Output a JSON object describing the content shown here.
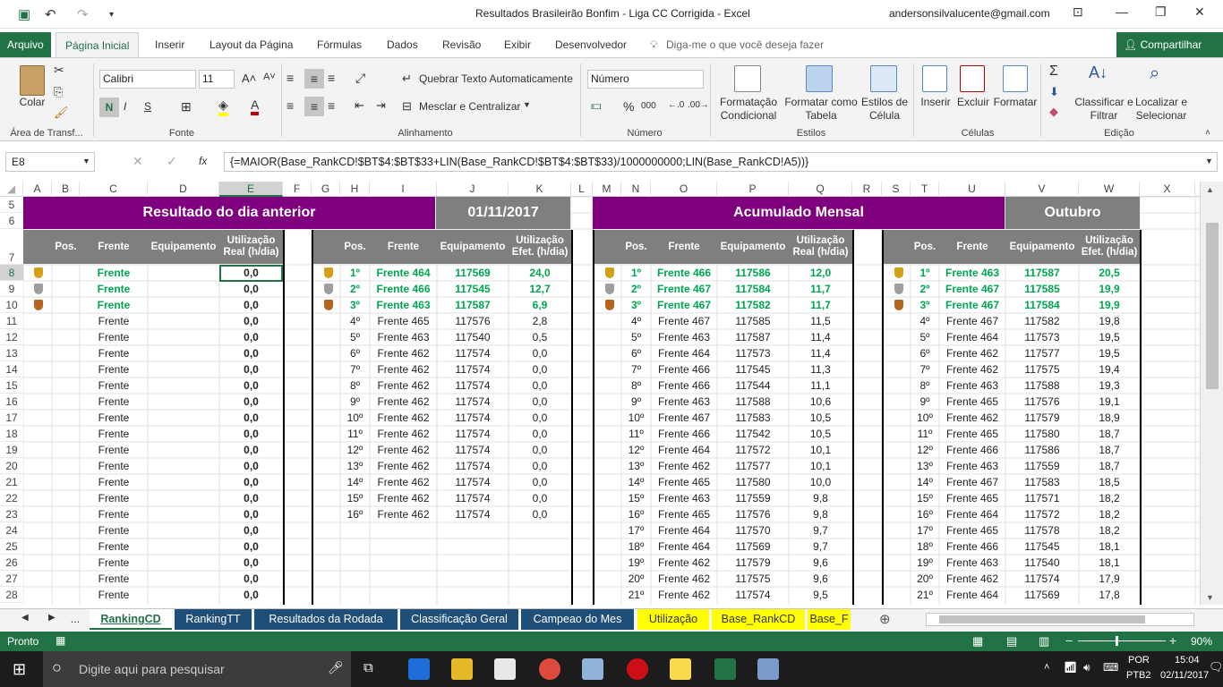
{
  "window": {
    "title": "Resultados Brasileirão Bonfim - Liga CC Corrigida  -  Excel",
    "user": "andersonsilvalucente@gmail.com"
  },
  "ribbon_tabs": [
    "Arquivo",
    "Página Inicial",
    "Inserir",
    "Layout da Página",
    "Fórmulas",
    "Dados",
    "Revisão",
    "Exibir",
    "Desenvolvedor"
  ],
  "tell_me": "Diga-me o que você deseja fazer",
  "share": "Compartilhar",
  "ribbon": {
    "paste": "Colar",
    "clipboard_group": "Área de Transf...",
    "font_name": "Calibri",
    "font_size": "11",
    "font_group": "Fonte",
    "bold": "N",
    "italic": "I",
    "underline": "S",
    "wrap_text": "Quebrar Texto Automaticamente",
    "merge_center": "Mesclar e Centralizar",
    "alignment_group": "Alinhamento",
    "number_format": "Número",
    "number_group": "Número",
    "percent": "%",
    "thousands": "000",
    "cond_format": "Formatação Condicional",
    "format_table": "Formatar como Tabela",
    "cell_styles": "Estilos de Célula",
    "styles_group": "Estilos",
    "insert": "Inserir",
    "delete": "Excluir",
    "format": "Formatar",
    "cells_group": "Células",
    "sort_filter": "Classificar e Filtrar",
    "find_select": "Localizar e Selecionar",
    "editing_group": "Edição"
  },
  "formula_bar": {
    "name_box": "E8",
    "fx": "fx",
    "formula": "{=MAIOR(Base_RankCD!$BT$4:$BT$33+LIN(Base_RankCD!$BT$4:$BT$33)/1000000000;LIN(Base_RankCD!A5))}"
  },
  "columns": [
    "A",
    "B",
    "C",
    "D",
    "E",
    "F",
    "G",
    "H",
    "I",
    "J",
    "K",
    "L",
    "M",
    "N",
    "O",
    "P",
    "Q",
    "R",
    "S",
    "T",
    "U",
    "V",
    "W",
    "X"
  ],
  "rows": [
    "5",
    "6",
    "7",
    "8",
    "9",
    "10",
    "11",
    "12",
    "13",
    "14",
    "15",
    "16",
    "17",
    "18",
    "19",
    "20",
    "21",
    "22",
    "23",
    "24",
    "25",
    "26",
    "27",
    "28"
  ],
  "sheet": {
    "banner_prev": "Resultado do dia anterior",
    "date_prev": "01/11/2017",
    "banner_month": "Acumulado Mensal",
    "month": "Outubro",
    "h_pos": "Pos.",
    "h_frente": "Frente",
    "h_equip": "Equipamento",
    "h_util_real": "Utilização Real (h/dia)",
    "h_util_efet": "Utilização Efet. (h/dia)",
    "block1": [
      [
        "Frente",
        "",
        "0,0"
      ],
      [
        "Frente",
        "",
        "0,0"
      ],
      [
        "Frente",
        "",
        "0,0"
      ],
      [
        "Frente",
        "",
        "0,0"
      ],
      [
        "Frente",
        "",
        "0,0"
      ],
      [
        "Frente",
        "",
        "0,0"
      ],
      [
        "Frente",
        "",
        "0,0"
      ],
      [
        "Frente",
        "",
        "0,0"
      ],
      [
        "Frente",
        "",
        "0,0"
      ],
      [
        "Frente",
        "",
        "0,0"
      ],
      [
        "Frente",
        "",
        "0,0"
      ],
      [
        "Frente",
        "",
        "0,0"
      ],
      [
        "Frente",
        "",
        "0,0"
      ],
      [
        "Frente",
        "",
        "0,0"
      ],
      [
        "Frente",
        "",
        "0,0"
      ],
      [
        "Frente",
        "",
        "0,0"
      ],
      [
        "Frente",
        "",
        "0,0"
      ],
      [
        "Frente",
        "",
        "0,0"
      ],
      [
        "Frente",
        "",
        "0,0"
      ],
      [
        "Frente",
        "",
        "0,0"
      ],
      [
        "Frente",
        "",
        "0,0"
      ]
    ],
    "block2": [
      [
        "1º",
        "Frente 464",
        "117569",
        "24,0"
      ],
      [
        "2º",
        "Frente 466",
        "117545",
        "12,7"
      ],
      [
        "3º",
        "Frente 463",
        "117587",
        "6,9"
      ],
      [
        "4º",
        "Frente 465",
        "117576",
        "2,8"
      ],
      [
        "5º",
        "Frente 463",
        "117540",
        "0,5"
      ],
      [
        "6º",
        "Frente 462",
        "117574",
        "0,0"
      ],
      [
        "7º",
        "Frente 462",
        "117574",
        "0,0"
      ],
      [
        "8º",
        "Frente 462",
        "117574",
        "0,0"
      ],
      [
        "9º",
        "Frente 462",
        "117574",
        "0,0"
      ],
      [
        "10º",
        "Frente 462",
        "117574",
        "0,0"
      ],
      [
        "11º",
        "Frente 462",
        "117574",
        "0,0"
      ],
      [
        "12º",
        "Frente 462",
        "117574",
        "0,0"
      ],
      [
        "13º",
        "Frente 462",
        "117574",
        "0,0"
      ],
      [
        "14º",
        "Frente 462",
        "117574",
        "0,0"
      ],
      [
        "15º",
        "Frente 462",
        "117574",
        "0,0"
      ],
      [
        "16º",
        "Frente 462",
        "117574",
        "0,0"
      ]
    ],
    "block3": [
      [
        "1º",
        "Frente 466",
        "117586",
        "12,0"
      ],
      [
        "2º",
        "Frente 467",
        "117584",
        "11,7"
      ],
      [
        "3º",
        "Frente 467",
        "117582",
        "11,7"
      ],
      [
        "4º",
        "Frente 467",
        "117585",
        "11,5"
      ],
      [
        "5º",
        "Frente 463",
        "117587",
        "11,4"
      ],
      [
        "6º",
        "Frente 464",
        "117573",
        "11,4"
      ],
      [
        "7º",
        "Frente 466",
        "117545",
        "11,3"
      ],
      [
        "8º",
        "Frente 466",
        "117544",
        "11,1"
      ],
      [
        "9º",
        "Frente 463",
        "117588",
        "10,6"
      ],
      [
        "10º",
        "Frente 467",
        "117583",
        "10,5"
      ],
      [
        "11º",
        "Frente 466",
        "117542",
        "10,5"
      ],
      [
        "12º",
        "Frente 464",
        "117572",
        "10,1"
      ],
      [
        "13º",
        "Frente 462",
        "117577",
        "10,1"
      ],
      [
        "14º",
        "Frente 465",
        "117580",
        "10,0"
      ],
      [
        "15º",
        "Frente 463",
        "117559",
        "9,8"
      ],
      [
        "16º",
        "Frente 465",
        "117576",
        "9,8"
      ],
      [
        "17º",
        "Frente 464",
        "117570",
        "9,7"
      ],
      [
        "18º",
        "Frente 464",
        "117569",
        "9,7"
      ],
      [
        "19º",
        "Frente 462",
        "117579",
        "9,6"
      ],
      [
        "20º",
        "Frente 462",
        "117575",
        "9,6"
      ],
      [
        "21º",
        "Frente 462",
        "117574",
        "9,5"
      ]
    ],
    "block4": [
      [
        "1º",
        "Frente 463",
        "117587",
        "20,5"
      ],
      [
        "2º",
        "Frente 467",
        "117585",
        "19,9"
      ],
      [
        "3º",
        "Frente 467",
        "117584",
        "19,9"
      ],
      [
        "4º",
        "Frente 467",
        "117582",
        "19,8"
      ],
      [
        "5º",
        "Frente 464",
        "117573",
        "19,5"
      ],
      [
        "6º",
        "Frente 462",
        "117577",
        "19,5"
      ],
      [
        "7º",
        "Frente 462",
        "117575",
        "19,4"
      ],
      [
        "8º",
        "Frente 463",
        "117588",
        "19,3"
      ],
      [
        "9º",
        "Frente 465",
        "117576",
        "19,1"
      ],
      [
        "10º",
        "Frente 462",
        "117579",
        "18,9"
      ],
      [
        "11º",
        "Frente 465",
        "117580",
        "18,7"
      ],
      [
        "12º",
        "Frente 466",
        "117586",
        "18,7"
      ],
      [
        "13º",
        "Frente 463",
        "117559",
        "18,7"
      ],
      [
        "14º",
        "Frente 467",
        "117583",
        "18,5"
      ],
      [
        "15º",
        "Frente 465",
        "117571",
        "18,2"
      ],
      [
        "16º",
        "Frente 464",
        "117572",
        "18,2"
      ],
      [
        "17º",
        "Frente 465",
        "117578",
        "18,2"
      ],
      [
        "18º",
        "Frente 466",
        "117545",
        "18,1"
      ],
      [
        "19º",
        "Frente 463",
        "117540",
        "18,1"
      ],
      [
        "20º",
        "Frente 462",
        "117574",
        "17,9"
      ],
      [
        "21º",
        "Frente 464",
        "117569",
        "17,8"
      ]
    ]
  },
  "sheet_tabs": [
    {
      "label": "...",
      "color": "#f3f3f3",
      "fg": "#333"
    },
    {
      "label": "RankingCD",
      "color": "#ffffff",
      "fg": "#217346"
    },
    {
      "label": "RankingTT",
      "color": "#1f4e79",
      "fg": "#ffffff"
    },
    {
      "label": "Resultados da Rodada",
      "color": "#1f4e79",
      "fg": "#ffffff"
    },
    {
      "label": "Classificação Geral",
      "color": "#1f4e79",
      "fg": "#ffffff"
    },
    {
      "label": "Campeao do Mes",
      "color": "#1f4e79",
      "fg": "#ffffff"
    },
    {
      "label": "Utilização",
      "color": "#ffff00",
      "fg": "#333"
    },
    {
      "label": "Base_RankCD",
      "color": "#ffff00",
      "fg": "#333"
    },
    {
      "label": "Base_F",
      "color": "#ffff00",
      "fg": "#333"
    }
  ],
  "status": {
    "ready": "Pronto",
    "zoom": "90%"
  },
  "taskbar": {
    "search": "Digite aqui para pesquisar",
    "lang": "POR",
    "layout": "PTB2",
    "time": "15:04",
    "date": "02/11/2017"
  },
  "colors": {
    "purple": "#7f007f",
    "gray_header": "#7f7f7f",
    "green_top": "#00a651",
    "excel_green": "#217346"
  }
}
